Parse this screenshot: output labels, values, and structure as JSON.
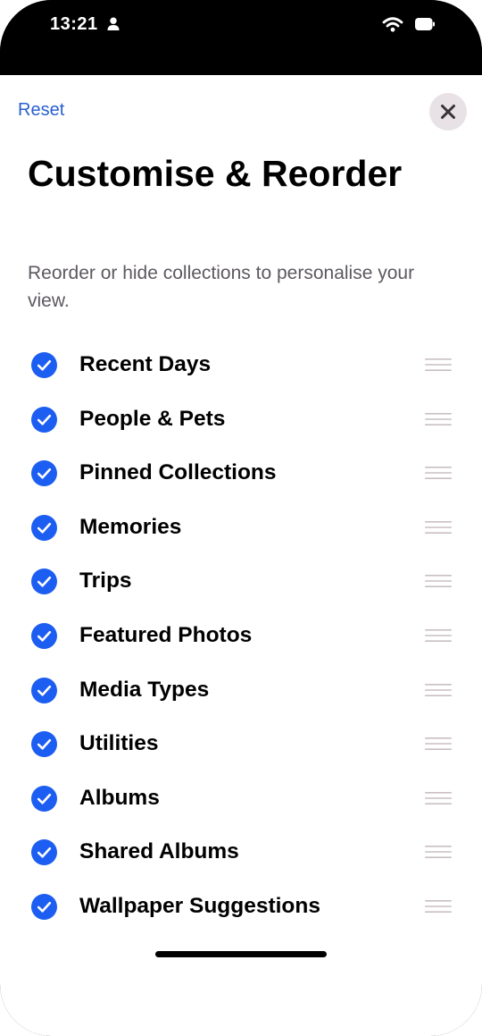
{
  "status_bar": {
    "time": "13:21",
    "icons": [
      "person-icon",
      "wifi-icon",
      "battery-icon"
    ]
  },
  "header": {
    "reset_label": "Reset",
    "close_icon": "close-icon"
  },
  "title": "Customise & Reorder",
  "subtitle": "Reorder or hide collections to personalise your view.",
  "collections": [
    {
      "label": "Recent Days",
      "checked": true
    },
    {
      "label": "People & Pets",
      "checked": true
    },
    {
      "label": "Pinned Collections",
      "checked": true
    },
    {
      "label": "Memories",
      "checked": true
    },
    {
      "label": "Trips",
      "checked": true
    },
    {
      "label": "Featured Photos",
      "checked": true
    },
    {
      "label": "Media Types",
      "checked": true
    },
    {
      "label": "Utilities",
      "checked": true
    },
    {
      "label": "Albums",
      "checked": true
    },
    {
      "label": "Shared Albums",
      "checked": true
    },
    {
      "label": "Wallpaper Suggestions",
      "checked": true
    }
  ],
  "colors": {
    "accent": "#1d5ef2",
    "reset_text": "#2a5fd0",
    "close_button_bg": "#e8e1e6",
    "handle": "#c9bfc4"
  }
}
